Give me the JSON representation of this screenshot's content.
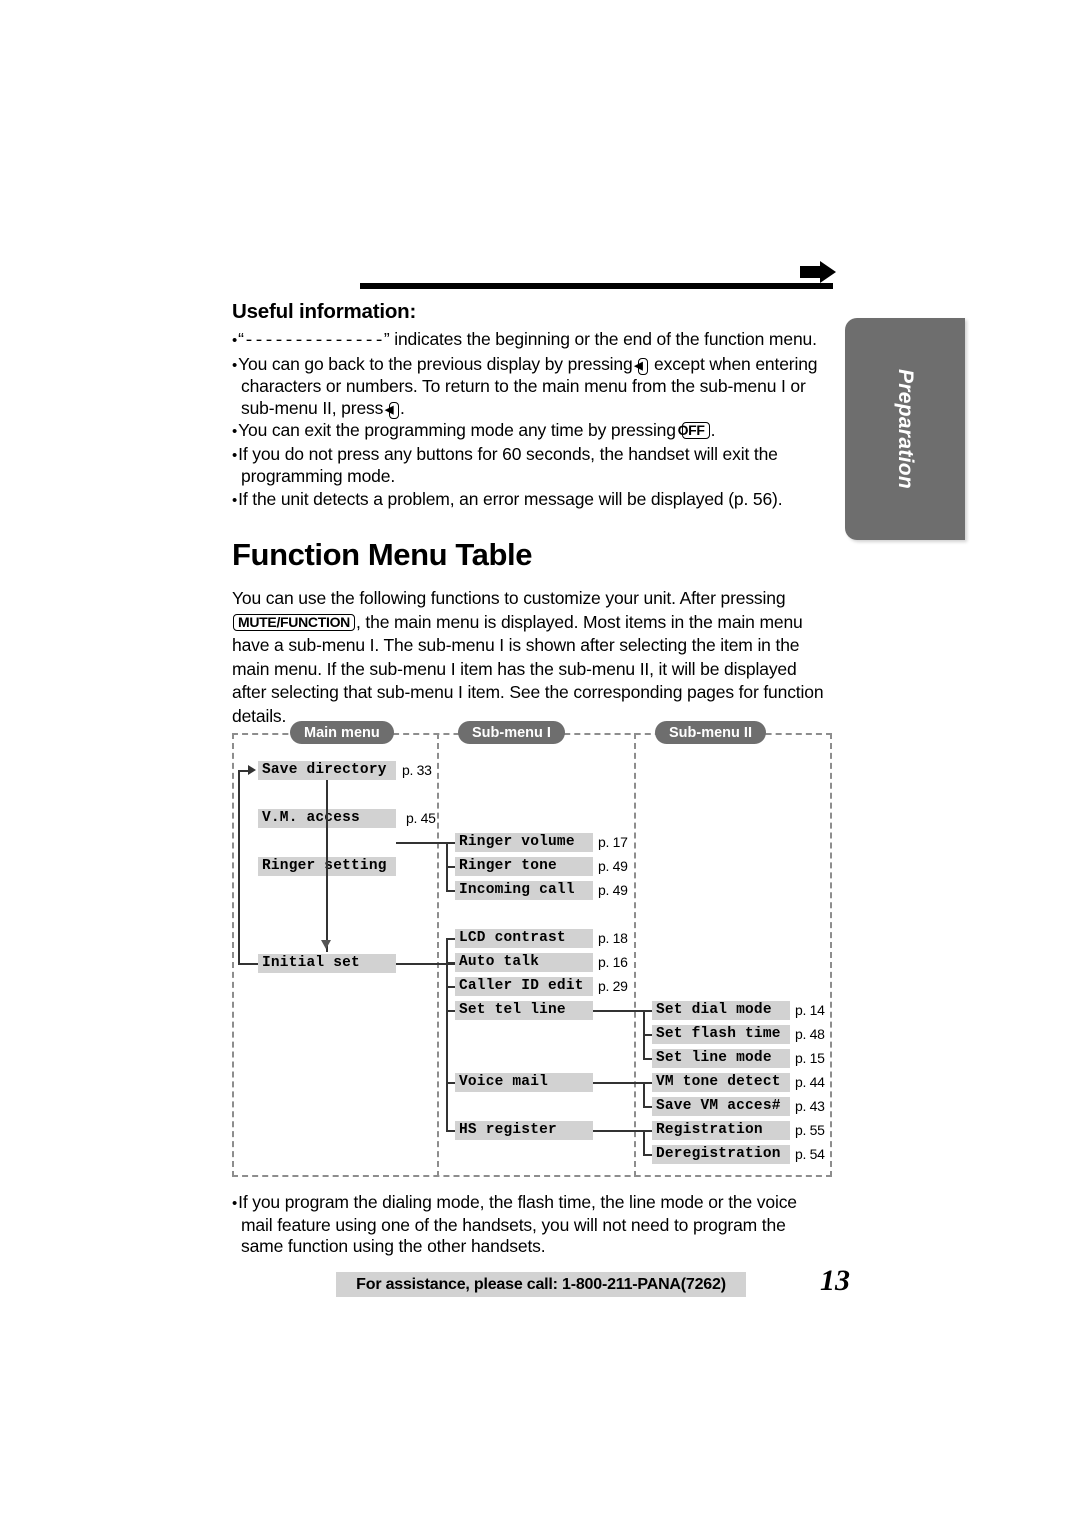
{
  "side_tab": {
    "label": "Preparation"
  },
  "useful": {
    "heading": "Useful information:",
    "b1_pre": "“",
    "b1_dashes": "--------------",
    "b1_post": "” indicates the beginning or the end of the function menu.",
    "b2_a": "You can go back to the previous display by pressing",
    "b2_key": "◀",
    "b2_b": "except when entering characters or numbers. To return to the main menu from the sub-menu I or sub-menu II, press",
    "b2_key2": "◀",
    "b2_c": ".",
    "b3_a": "You can exit the programming mode any time by pressing",
    "b3_key": "OFF",
    "b3_b": ".",
    "b4": "If you do not press any buttons for 60 seconds, the handset will exit the programming mode.",
    "b5": "If the unit detects a problem, an error message will be displayed (p. 56)."
  },
  "title": "Function Menu Table",
  "intro": {
    "a": "You can use the following functions to customize your unit. After pressing",
    "key": "MUTE/FUNCTION",
    "b": ", the main menu is displayed. Most items in the main menu have a sub-menu I. The sub-menu I is shown after selecting the item in the main menu. If the sub-menu I item has the sub-menu II, it will be displayed after selecting that sub-menu I item. See the corresponding pages for function details."
  },
  "diagram": {
    "columns": [
      {
        "title": "Main menu"
      },
      {
        "title": "Sub-menu I"
      },
      {
        "title": "Sub-menu II"
      }
    ],
    "main_menu": [
      {
        "label": "Save directory",
        "page": "p. 33"
      },
      {
        "label": "V.M. access",
        "page": "p. 45"
      },
      {
        "label": "Ringer setting",
        "page": ""
      },
      {
        "label": "Initial set",
        "page": ""
      }
    ],
    "sub_menu_1": [
      {
        "label": "Ringer volume",
        "page": "p. 17"
      },
      {
        "label": "Ringer tone",
        "page": "p. 49"
      },
      {
        "label": "Incoming call",
        "page": "p. 49"
      },
      {
        "label": "LCD contrast",
        "page": "p. 18"
      },
      {
        "label": "Auto talk",
        "page": "p. 16"
      },
      {
        "label": "Caller ID edit",
        "page": "p. 29"
      },
      {
        "label": "Set tel line",
        "page": ""
      },
      {
        "label": "Voice mail",
        "page": ""
      },
      {
        "label": "HS register",
        "page": ""
      }
    ],
    "sub_menu_2": [
      {
        "label": "Set dial mode",
        "page": "p. 14"
      },
      {
        "label": "Set flash time",
        "page": "p. 48"
      },
      {
        "label": "Set line mode",
        "page": "p. 15"
      },
      {
        "label": "VM tone detect",
        "page": "p. 44"
      },
      {
        "label": "Save VM acces#",
        "page": "p. 43"
      },
      {
        "label": "Registration",
        "page": "p. 55"
      },
      {
        "label": "Deregistration",
        "page": "p. 54"
      }
    ]
  },
  "footnote": "If you program the dialing mode, the flash time, the line mode or the voice mail feature using one of the handsets, you will not need to program the same function using the other handsets.",
  "assistance": "For assistance, please call: 1-800-211-PANA(7262)",
  "page_number": "13"
}
